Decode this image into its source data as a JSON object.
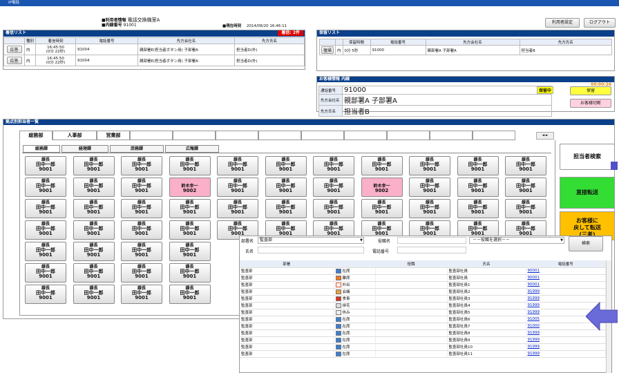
{
  "window": {
    "title": "IP電話"
  },
  "header": {
    "user_info_label": "■利用者情報",
    "user_info_value": "電話交換機室A",
    "ext_label": "■内線番号",
    "ext_value": "91001",
    "time_label": "■現在時刻",
    "time_value": "2014/08/20 16:46:11",
    "settings_button": "利用者設定",
    "logout_button": "ログアウト"
  },
  "incoming": {
    "title": "着信リスト",
    "badge": "着信: 2件",
    "columns": [
      "",
      "種別",
      "着信時刻",
      "電話番号",
      "先方会社名",
      "先方氏名"
    ],
    "rows": [
      {
        "action": "応答",
        "type": "内",
        "time1": "16:45:50",
        "time2": "(0分 22秒)",
        "phone": "91004",
        "company": "親部署E(担当者ボタン用) 子部署A",
        "person": "担当者D(外)"
      },
      {
        "action": "応答",
        "type": "内",
        "time1": "16:45:50",
        "time2": "(0分 22秒)",
        "phone": "91004",
        "company": "親部署E(担当者ボタン用) 子部署A",
        "person": "担当者D(外)"
      }
    ]
  },
  "hold": {
    "title": "保留リスト",
    "columns": [
      "",
      "",
      "保留時間",
      "電話番号",
      "先方会社名",
      "先方氏名"
    ],
    "rows": [
      {
        "action": "復帰",
        "type": "内",
        "duration": "0分 5秒",
        "phone": "91000",
        "company": "親部署A 子部署A",
        "person": "担当者B"
      }
    ]
  },
  "call": {
    "title": "お客様情報 内線",
    "timer": "00:00:26",
    "number_label": "通話番号",
    "number": "91000",
    "status": "保留中",
    "company_label": "先方会社名",
    "company": "親部署A 子部署A",
    "person_label": "先方氏名",
    "person": "担当者B",
    "hold_button": "保留",
    "disconnect_button": "お客様切断"
  },
  "staff": {
    "title": "拠点別担当者一覧",
    "dept_tabs": [
      "総務部",
      "人事部",
      "営業部"
    ],
    "sub_tabs": [
      "総務課",
      "経理課",
      "庶務課",
      "広報課"
    ],
    "cell_role": "課長",
    "cell_name": "田中一郎",
    "cell_ext": "9001",
    "pink_name": "鈴木幸一",
    "pink_ext": "9002",
    "scroll_arrows": "◄ ►"
  },
  "actions": {
    "search_staff": "担当者検索",
    "direct_transfer": "直接転送",
    "return_transfer_line1": "お客様に",
    "return_transfer_line2": "戻して転送",
    "return_transfer_line3": "(三者)"
  },
  "search": {
    "dept_label": "部署名",
    "dept_value": "監査部",
    "role_label": "役職名",
    "role_value": "－－役職を選択－－",
    "name_label": "氏名",
    "phone_label": "電話番号",
    "search_button": "検索",
    "columns": [
      "部署",
      "",
      "役職",
      "氏名",
      "電話番号"
    ],
    "rows": [
      {
        "dept": "監査部",
        "icon": "si-blue",
        "status": "在席",
        "role": "",
        "name": "監査部社員",
        "phone": "90001"
      },
      {
        "dept": "監査部",
        "icon": "si-orange",
        "status": "離席",
        "role": "",
        "name": "監査部社員",
        "phone": "90001"
      },
      {
        "dept": "監査部",
        "icon": "si-white",
        "status": "外出",
        "role": "",
        "name": "監査部社員1",
        "phone": "90001"
      },
      {
        "dept": "監査部",
        "icon": "si-tan",
        "status": "会議",
        "role": "",
        "name": "監査部社員2",
        "phone": "91999"
      },
      {
        "dept": "監査部",
        "icon": "si-red",
        "status": "食事",
        "role": "",
        "name": "監査部社員3",
        "phone": "91999"
      },
      {
        "dept": "監査部",
        "icon": "si-gray",
        "status": "帰宅",
        "role": "",
        "name": "監査部社員4",
        "phone": "91999"
      },
      {
        "dept": "監査部",
        "icon": "si-lgray",
        "status": "休み",
        "role": "",
        "name": "監査部社員5",
        "phone": "91999"
      },
      {
        "dept": "監査部",
        "icon": "si-blue",
        "status": "在席",
        "role": "",
        "name": "監査部社員6",
        "phone": "91005"
      },
      {
        "dept": "監査部",
        "icon": "si-blue",
        "status": "在席",
        "role": "",
        "name": "監査部社員7",
        "phone": "91000"
      },
      {
        "dept": "監査部",
        "icon": "si-blue",
        "status": "在席",
        "role": "",
        "name": "監査部社員8",
        "phone": "91999"
      },
      {
        "dept": "監査部",
        "icon": "si-blue",
        "status": "在席",
        "role": "",
        "name": "監査部社員9",
        "phone": "91999"
      },
      {
        "dept": "監査部",
        "icon": "si-blue",
        "status": "在席",
        "role": "",
        "name": "監査部社員10",
        "phone": "91999"
      },
      {
        "dept": "監査部",
        "icon": "si-blue",
        "status": "在席",
        "role": "",
        "name": "監査部社員11",
        "phone": "91999"
      }
    ]
  },
  "colors": {
    "header_blue": "#0a3f8a",
    "badge_red": "#e00000",
    "hold_yellow": "#ffff00",
    "pink": "#f9b0c8",
    "green": "#33dd33",
    "orange": "#ffc000",
    "arrow_blue": "#5050c8"
  }
}
